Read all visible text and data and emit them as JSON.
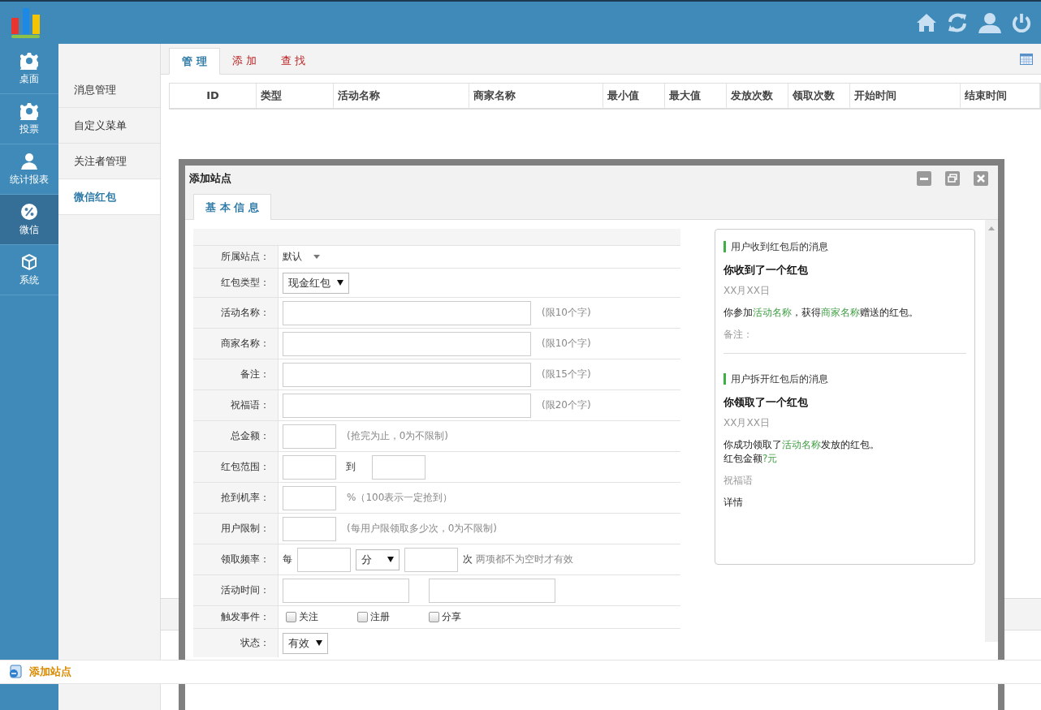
{
  "nav": [
    {
      "label": "桌面",
      "kind": "gear",
      "selected": false
    },
    {
      "label": "投票",
      "kind": "gear",
      "selected": false
    },
    {
      "label": "统计报表",
      "kind": "person",
      "selected": false
    },
    {
      "label": "微信",
      "kind": "percent",
      "selected": true
    },
    {
      "label": "系统",
      "kind": "box",
      "selected": false
    }
  ],
  "submenu": [
    {
      "label": "消息管理",
      "selected": false
    },
    {
      "label": "自定义菜单",
      "selected": false
    },
    {
      "label": "关注者管理",
      "selected": false
    },
    {
      "label": "微信红包",
      "selected": true
    }
  ],
  "tabs": [
    {
      "label": "管 理",
      "selected": true
    },
    {
      "label": "添 加",
      "selected": false
    },
    {
      "label": "查 找",
      "selected": false
    }
  ],
  "table": {
    "columns": [
      "ID",
      "类型",
      "活动名称",
      "商家名称",
      "最小值",
      "最大值",
      "发放次数",
      "领取次数",
      "开始时间",
      "结束时间"
    ]
  },
  "dialog": {
    "title": "添加站点",
    "tabs": [
      {
        "label": "基 本 信 息",
        "selected": true
      }
    ],
    "form": [
      {
        "label": "所属站点：",
        "kind": "dropdown",
        "value": "默认"
      },
      {
        "label": "红包类型：",
        "kind": "select",
        "value": "现金红包"
      },
      {
        "label": "活动名称：",
        "kind": "text",
        "hint": "(限10个字)"
      },
      {
        "label": "商家名称：",
        "kind": "text",
        "hint": "(限10个字)"
      },
      {
        "label": "备注：",
        "kind": "text",
        "hint": "(限15个字)"
      },
      {
        "label": "祝福语：",
        "kind": "text",
        "hint": "(限20个字)"
      },
      {
        "label": "总金额：",
        "kind": "small",
        "hint": "(抢完为止，0为不限制)"
      },
      {
        "label": "红包范围：",
        "kind": "range",
        "joiner": "到"
      },
      {
        "label": "抢到机率：",
        "kind": "small",
        "hint": "%（100表示一定抢到）"
      },
      {
        "label": "用户限制：",
        "kind": "small",
        "hint": "(每用户限领取多少次，0为不限制)"
      },
      {
        "label": "领取频率：",
        "kind": "frequency",
        "prefix": "每",
        "unit": "分",
        "suffix": "次",
        "hint": "两项都不为空时才有效"
      },
      {
        "label": "活动时间：",
        "kind": "dates"
      },
      {
        "label": "触发事件：",
        "kind": "checkboxes",
        "options": [
          {
            "label": "关注",
            "checked": false
          },
          {
            "label": "注册",
            "checked": false
          },
          {
            "label": "分享",
            "checked": false
          }
        ]
      },
      {
        "label": "状态：",
        "kind": "select",
        "value": "有效"
      }
    ],
    "preview": [
      {
        "heading": "用户收到红包后的消息",
        "title": "你收到了一个红包",
        "date": "XX月XX日",
        "paragraphs": [
          {
            "muted": false,
            "lines": [
              [
                {
                  "text": "你参加",
                  "highlight": false
                },
                {
                  "text": "活动名称",
                  "highlight": true
                },
                {
                  "text": "，获得",
                  "highlight": false
                },
                {
                  "text": "商家名称",
                  "highlight": true
                },
                {
                  "text": "赠送的红包。",
                  "highlight": false
                }
              ]
            ]
          },
          {
            "muted": true,
            "lines": [
              [
                {
                  "text": "备注：",
                  "highlight": false
                }
              ]
            ]
          }
        ]
      },
      {
        "heading": "用户拆开红包后的消息",
        "title": "你领取了一个红包",
        "date": "XX月XX日",
        "paragraphs": [
          {
            "muted": false,
            "lines": [
              [
                {
                  "text": "你成功领取了",
                  "highlight": false
                },
                {
                  "text": "活动名称",
                  "highlight": true
                },
                {
                  "text": "发放的红包。",
                  "highlight": false
                }
              ],
              [
                {
                  "text": "红包金额",
                  "highlight": false
                },
                {
                  "text": "?元",
                  "highlight": true
                }
              ]
            ]
          },
          {
            "muted": true,
            "lines": [
              [
                {
                  "text": "祝福语",
                  "highlight": false
                }
              ]
            ]
          },
          {
            "muted": false,
            "lines": [
              [
                {
                  "text": "详情",
                  "highlight": false
                }
              ]
            ]
          }
        ]
      }
    ]
  },
  "taskbar": {
    "items": [
      {
        "label": "添加站点"
      }
    ]
  }
}
